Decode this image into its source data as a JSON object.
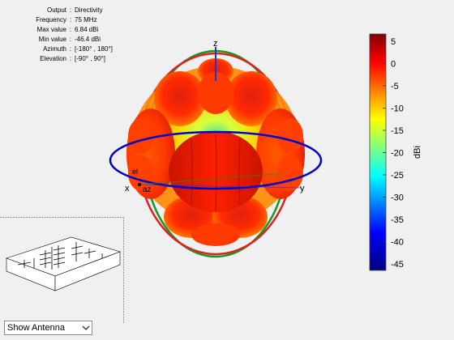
{
  "info": [
    {
      "key": "Output",
      "value": "Directivity"
    },
    {
      "key": "Frequency",
      "value": "75 MHz"
    },
    {
      "key": "Max value",
      "value": "6.84 dBi"
    },
    {
      "key": "Min value",
      "value": "-46.4 dBi"
    },
    {
      "key": "Azimuth",
      "value": "[-180° , 180°]"
    },
    {
      "key": "Elevation",
      "value": "[-90° , 90°]"
    }
  ],
  "info_separator": ":",
  "axes": {
    "z": "z",
    "x": "x",
    "y": "y",
    "az": "az",
    "el": "el"
  },
  "colorbar": {
    "label": "dBi",
    "ticks": [
      "5",
      "0",
      "-5",
      "-10",
      "-15",
      "-20",
      "-25",
      "-30",
      "-35",
      "-40",
      "-45"
    ]
  },
  "view_select": {
    "value": "Show Antenna"
  },
  "colors": {
    "azimuth_ring": "#0000cc",
    "elevation_ring_xz": "#dd2222",
    "elevation_ring_yz": "#119922",
    "z_axis": "#2233dd"
  },
  "icons": {
    "dropdown": "chevron-down-icon"
  }
}
